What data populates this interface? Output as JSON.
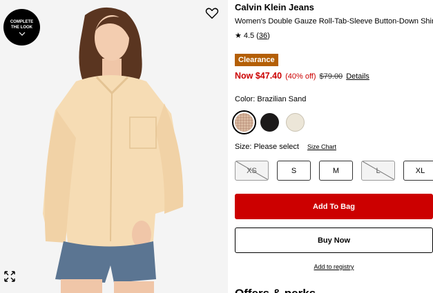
{
  "image_panel": {
    "complete_look_label": "COMPLETE THE LOOK",
    "favorite_icon": "heart-icon",
    "expand_icon": "expand-icon"
  },
  "product": {
    "brand": "Calvin Klein Jeans",
    "title": "Women's Double Gauze Roll-Tab-Sleeve Button-Down Shirt",
    "rating": "4.5",
    "review_count": "36",
    "badge": "Clearance",
    "price_now": "Now $47.40",
    "price_off": "(40% off)",
    "price_was": "$79.00",
    "details_link": "Details"
  },
  "color": {
    "label": "Color: Brazilian Sand",
    "swatches": [
      {
        "name": "Brazilian Sand",
        "color": "#d9b9a0",
        "selected": true
      },
      {
        "name": "Black",
        "color": "#1c1a1a",
        "selected": false
      },
      {
        "name": "Ivory",
        "color": "#ece6d8",
        "selected": false
      }
    ]
  },
  "size": {
    "label": "Size: Please select",
    "chart_link": "Size Chart",
    "options": [
      {
        "label": "XS",
        "available": false
      },
      {
        "label": "S",
        "available": true
      },
      {
        "label": "M",
        "available": true
      },
      {
        "label": "L",
        "available": false
      },
      {
        "label": "XL",
        "available": true
      }
    ]
  },
  "actions": {
    "add_to_bag": "Add To Bag",
    "buy_now": "Buy Now",
    "registry": "Add to registry"
  },
  "sections": {
    "offers_heading": "Offers & perks"
  },
  "colors": {
    "accent_red": "#cc0000",
    "clearance_badge": "#b45f06"
  }
}
